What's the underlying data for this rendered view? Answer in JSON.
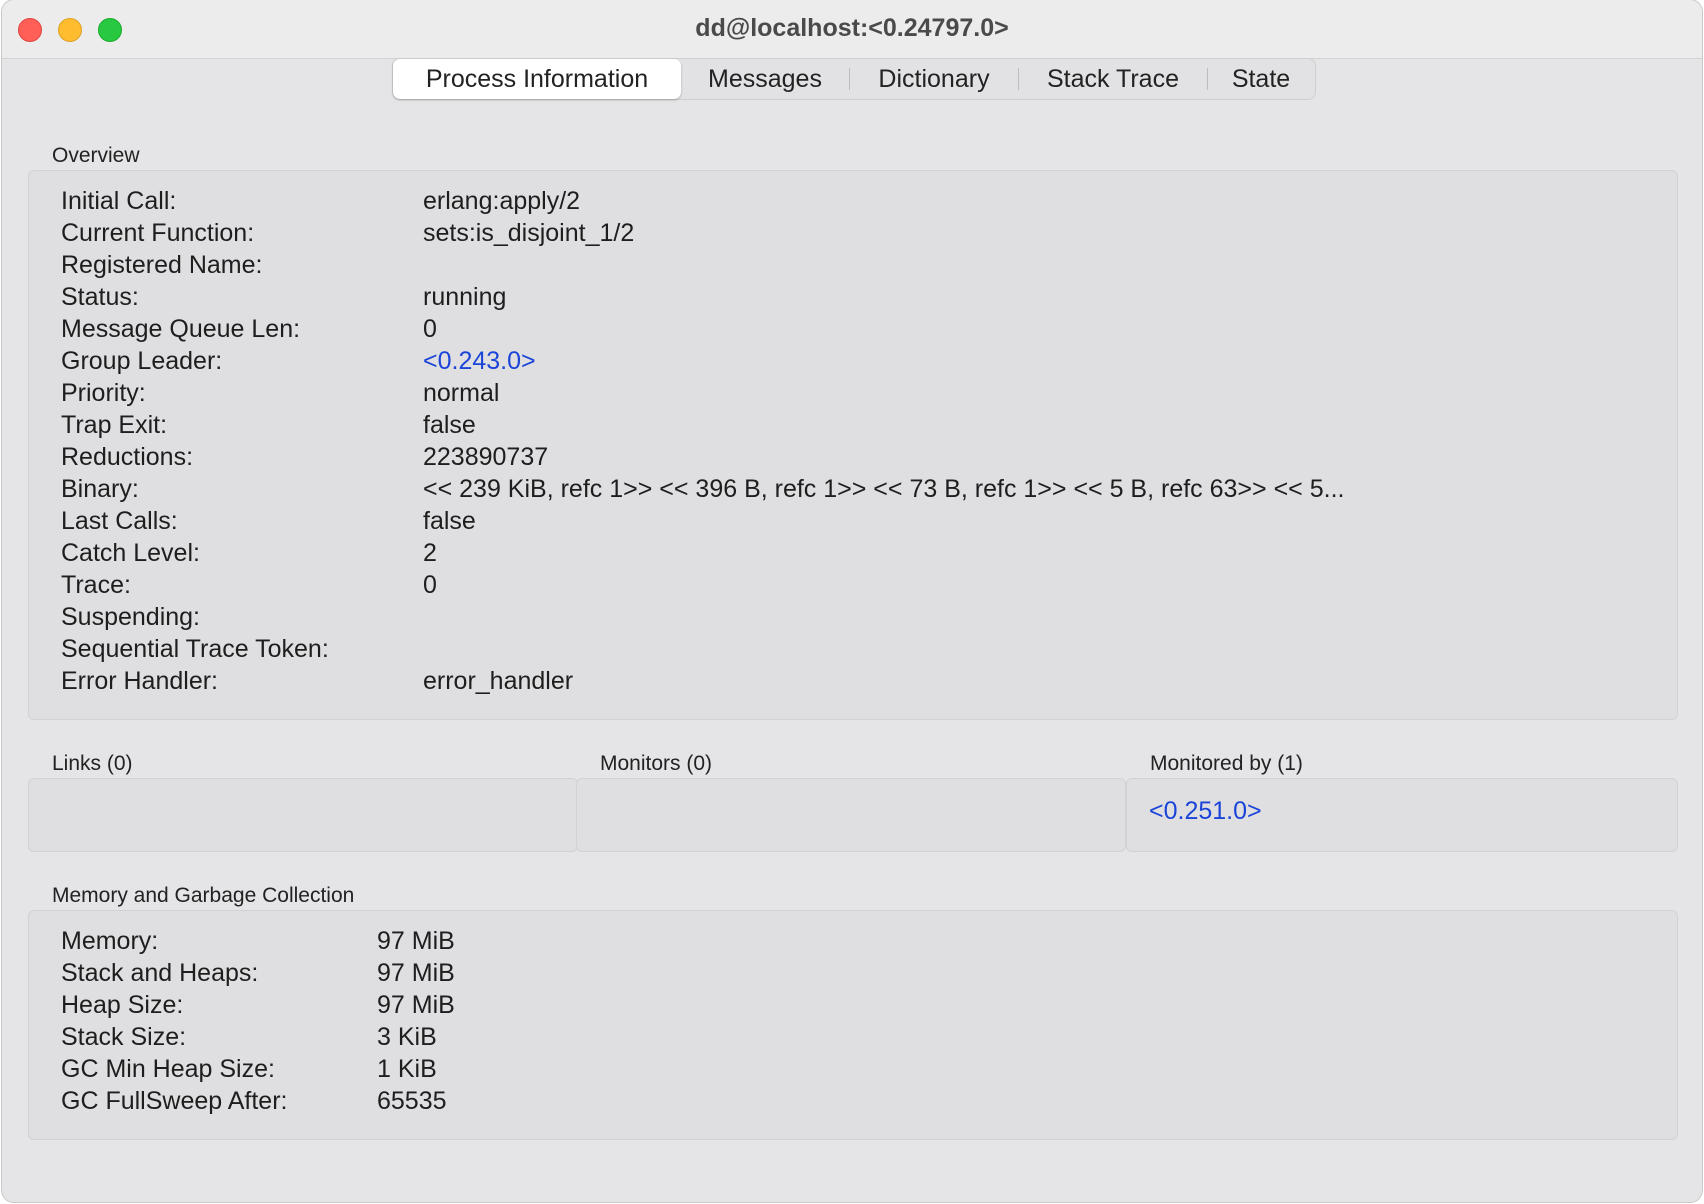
{
  "window": {
    "title": "dd@localhost:<0.24797.0>"
  },
  "tabs": [
    {
      "label": "Process Information",
      "active": true
    },
    {
      "label": "Messages",
      "active": false
    },
    {
      "label": "Dictionary",
      "active": false
    },
    {
      "label": "Stack Trace",
      "active": false
    },
    {
      "label": "State",
      "active": false
    }
  ],
  "overview": {
    "label": "Overview",
    "rows": [
      {
        "key": "Initial Call:",
        "value": "erlang:apply/2"
      },
      {
        "key": "Current Function:",
        "value": "sets:is_disjoint_1/2"
      },
      {
        "key": "Registered Name:",
        "value": ""
      },
      {
        "key": "Status:",
        "value": "running"
      },
      {
        "key": "Message Queue Len:",
        "value": "0"
      },
      {
        "key": "Group Leader:",
        "value": "<0.243.0>"
      },
      {
        "key": "Priority:",
        "value": "normal"
      },
      {
        "key": "Trap Exit:",
        "value": "false"
      },
      {
        "key": "Reductions:",
        "value": "223890737"
      },
      {
        "key": "Binary:",
        "value": "<< 239 KiB, refc 1>> << 396 B, refc 1>> << 73 B, refc 1>> << 5 B, refc 63>> << 5..."
      },
      {
        "key": "Last Calls:",
        "value": "false"
      },
      {
        "key": "Catch Level:",
        "value": "2"
      },
      {
        "key": "Trace:",
        "value": "0"
      },
      {
        "key": "Suspending:",
        "value": ""
      },
      {
        "key": "Sequential Trace Token:",
        "value": ""
      },
      {
        "key": "Error Handler:",
        "value": "error_handler"
      }
    ]
  },
  "links": {
    "label": "Links (0)"
  },
  "monitors": {
    "label": "Monitors (0)"
  },
  "monitored_by": {
    "label": "Monitored by (1)",
    "items": [
      "<0.251.0>"
    ]
  },
  "memory": {
    "label": "Memory and Garbage Collection",
    "rows": [
      {
        "key": "Memory:",
        "value": "97 MiB"
      },
      {
        "key": "Stack and Heaps:",
        "value": "97 MiB"
      },
      {
        "key": "Heap Size:",
        "value": "97 MiB"
      },
      {
        "key": "Stack Size:",
        "value": "3 KiB"
      },
      {
        "key": "GC Min Heap Size:",
        "value": "1 KiB"
      },
      {
        "key": "GC FullSweep After:",
        "value": "65535"
      }
    ]
  },
  "colors": {
    "link": "#1b44d8",
    "window_bg": "#e5e5e7"
  }
}
